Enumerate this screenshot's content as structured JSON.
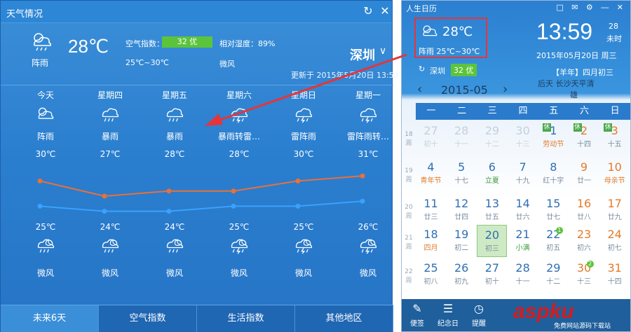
{
  "weather": {
    "title": "天气情况",
    "current": {
      "temp": "28℃",
      "desc": "阵雨",
      "aqi_label": "空气指数：",
      "aqi_value": "32 优",
      "humidity": "相对湿度：89%",
      "range": "25℃~30℃",
      "wind": "微风"
    },
    "city": "深圳",
    "updated": "更新于 2015年5月20日 13:59",
    "days": [
      {
        "name": "今天",
        "cond": "阵雨",
        "hi": "30℃",
        "lo": "25℃",
        "wind": "微风",
        "icon": "rain-sun-icon"
      },
      {
        "name": "星期四",
        "cond": "暴雨",
        "hi": "27℃",
        "lo": "24℃",
        "wind": "微风",
        "icon": "heavy-rain-icon"
      },
      {
        "name": "星期五",
        "cond": "暴雨",
        "hi": "28℃",
        "lo": "24℃",
        "wind": "微风",
        "icon": "heavy-rain-icon"
      },
      {
        "name": "星期六",
        "cond": "暴雨转雷…",
        "hi": "28℃",
        "lo": "25℃",
        "wind": "微风",
        "icon": "thunder-rain-icon"
      },
      {
        "name": "星期日",
        "cond": "雷阵雨",
        "hi": "30℃",
        "lo": "25℃",
        "wind": "微风",
        "icon": "thunder-rain-icon"
      },
      {
        "name": "星期一",
        "cond": "雷阵雨转…",
        "hi": "31℃",
        "lo": "26℃",
        "wind": "微风",
        "icon": "thunder-rain-icon"
      }
    ],
    "tabs": [
      "未来6天",
      "空气指数",
      "生活指数",
      "其他地区"
    ]
  },
  "chart_data": {
    "type": "line",
    "categories": [
      "今天",
      "星期四",
      "星期五",
      "星期六",
      "星期日",
      "星期一"
    ],
    "series": [
      {
        "values": [
          30,
          27,
          28,
          28,
          30,
          31
        ],
        "color": "#e8703a"
      },
      {
        "values": [
          25,
          24,
          24,
          25,
          25,
          26
        ],
        "color": "#39a2ff"
      }
    ]
  },
  "calendar": {
    "title": "人生日历",
    "weather_temp": "28℃",
    "weather_desc": "阵雨 25℃~30℃",
    "city": "深圳",
    "aqi": "32 优",
    "time": "13:59",
    "sec": "28",
    "sec_label": "未时",
    "date": "2015年05月20日 周三",
    "lunar": "【羊年】四月初三",
    "month": "2015-05",
    "location": "后天 长沙天平清",
    "location2": "雄",
    "weekdays": [
      "一",
      "二",
      "三",
      "四",
      "五",
      "六",
      "日"
    ],
    "weeks": [
      "18周",
      "19周",
      "20周",
      "21周",
      "22周"
    ],
    "rows": [
      [
        {
          "d": "27",
          "l": "初十",
          "dim": true
        },
        {
          "d": "28",
          "l": "十一",
          "dim": true
        },
        {
          "d": "29",
          "l": "十二",
          "dim": true
        },
        {
          "d": "30",
          "l": "十三",
          "dim": true
        },
        {
          "d": "1",
          "l": "劳动节",
          "fest": true,
          "badge": "休"
        },
        {
          "d": "2",
          "l": "十四",
          "weekend": true,
          "badge": "休"
        },
        {
          "d": "3",
          "l": "十五",
          "weekend": true,
          "badge": "休"
        }
      ],
      [
        {
          "d": "4",
          "l": "青年节",
          "fest": true
        },
        {
          "d": "5",
          "l": "十七"
        },
        {
          "d": "6",
          "l": "立夏",
          "solar": true
        },
        {
          "d": "7",
          "l": "十九"
        },
        {
          "d": "8",
          "l": "红十字"
        },
        {
          "d": "9",
          "l": "廿一",
          "weekend": true
        },
        {
          "d": "10",
          "l": "母亲节",
          "weekend": true,
          "fest": true
        }
      ],
      [
        {
          "d": "11",
          "l": "廿三"
        },
        {
          "d": "12",
          "l": "廿四"
        },
        {
          "d": "13",
          "l": "廿五"
        },
        {
          "d": "14",
          "l": "廿六"
        },
        {
          "d": "15",
          "l": "廿七"
        },
        {
          "d": "16",
          "l": "廿八",
          "weekend": true
        },
        {
          "d": "17",
          "l": "廿九",
          "weekend": true
        }
      ],
      [
        {
          "d": "18",
          "l": "四月",
          "fest": true
        },
        {
          "d": "19",
          "l": "初二"
        },
        {
          "d": "20",
          "l": "初三",
          "today": true
        },
        {
          "d": "21",
          "l": "小满",
          "solar": true
        },
        {
          "d": "22",
          "l": "初五",
          "dot": "1"
        },
        {
          "d": "23",
          "l": "初六",
          "weekend": true
        },
        {
          "d": "24",
          "l": "初七",
          "weekend": true
        }
      ],
      [
        {
          "d": "25",
          "l": "初八"
        },
        {
          "d": "26",
          "l": "初九"
        },
        {
          "d": "27",
          "l": "初十"
        },
        {
          "d": "28",
          "l": "十一"
        },
        {
          "d": "29",
          "l": "十二"
        },
        {
          "d": "30",
          "l": "十三",
          "weekend": true,
          "dot": "2"
        },
        {
          "d": "31",
          "l": "十四",
          "weekend": true
        }
      ]
    ],
    "bottom": [
      {
        "label": "便签",
        "icon": "note-icon"
      },
      {
        "label": "纪念日",
        "icon": "cake-icon"
      },
      {
        "label": "提醒",
        "icon": "alarm-icon"
      }
    ]
  },
  "watermark": {
    "text": "aspku",
    "sub": "免费网站源码下载站"
  }
}
